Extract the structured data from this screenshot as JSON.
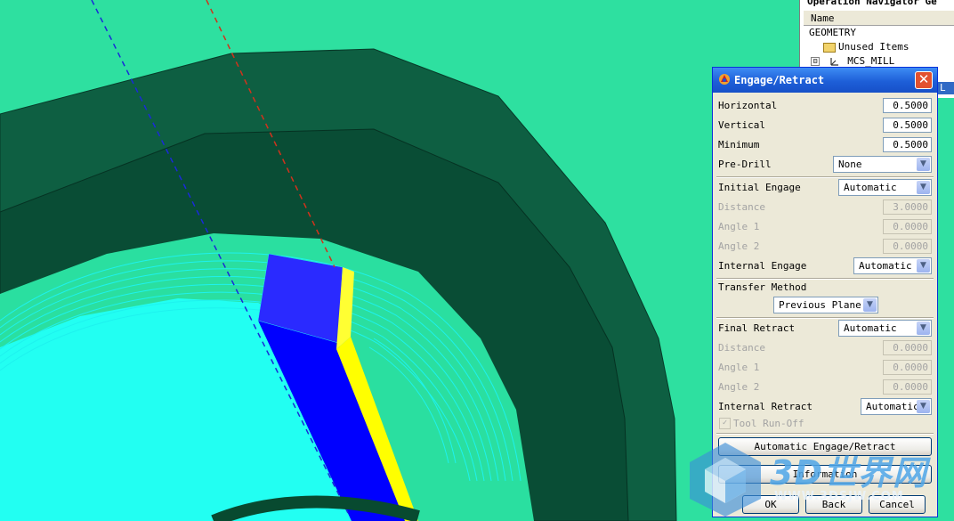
{
  "navigator": {
    "title": "Operation Navigator",
    "title_suffix": "Ge",
    "column_name": "Name",
    "items": [
      {
        "label": "GEOMETRY"
      },
      {
        "label": "Unused Items"
      },
      {
        "label": "MCS_MILL"
      }
    ],
    "expander": "⊟",
    "selected_tail": "L"
  },
  "dialog": {
    "title": "Engage/Retract",
    "close_glyph": "✕",
    "fields": {
      "horizontal": {
        "label": "Horizontal",
        "value": "0.5000"
      },
      "vertical": {
        "label": "Vertical",
        "value": "0.5000"
      },
      "minimum": {
        "label": "Minimum",
        "value": "0.5000"
      },
      "pre_drill": {
        "label": "Pre-Drill",
        "value": "None"
      },
      "initial_engage": {
        "label": "Initial Engage",
        "value": "Automatic"
      },
      "ie_distance": {
        "label": "Distance",
        "value": "3.0000"
      },
      "ie_angle1": {
        "label": "Angle 1",
        "value": "0.0000"
      },
      "ie_angle2": {
        "label": "Angle 2",
        "value": "0.0000"
      },
      "internal_engage": {
        "label": "Internal Engage",
        "value": "Automatic"
      },
      "transfer_method": {
        "label": "Transfer Method",
        "value": "Previous Plane"
      },
      "final_retract": {
        "label": "Final Retract",
        "value": "Automatic"
      },
      "fr_distance": {
        "label": "Distance",
        "value": "0.0000"
      },
      "fr_angle1": {
        "label": "Angle 1",
        "value": "0.0000"
      },
      "fr_angle2": {
        "label": "Angle 2",
        "value": "0.0000"
      },
      "internal_retract": {
        "label": "Internal Retract",
        "value": "Automatic"
      },
      "tool_runoff": {
        "label": "Tool Run-Off",
        "checked": true
      }
    },
    "buttons": {
      "auto_engage": "Automatic Engage/Retract",
      "information": "Information",
      "ok": "OK",
      "back": "Back",
      "cancel": "Cancel"
    },
    "dropdown_arrow": "▼"
  },
  "watermark": {
    "logo_text": "3D世界网",
    "url": "WWW.3DSJW.COM"
  },
  "colors": {
    "background": "#2ee0a0",
    "dark_green": "#0b5b40",
    "mid_green": "#08714c",
    "cyan": "#20fff0",
    "tool_blue": "#0000ff",
    "tool_yellow": "#ffff00"
  }
}
